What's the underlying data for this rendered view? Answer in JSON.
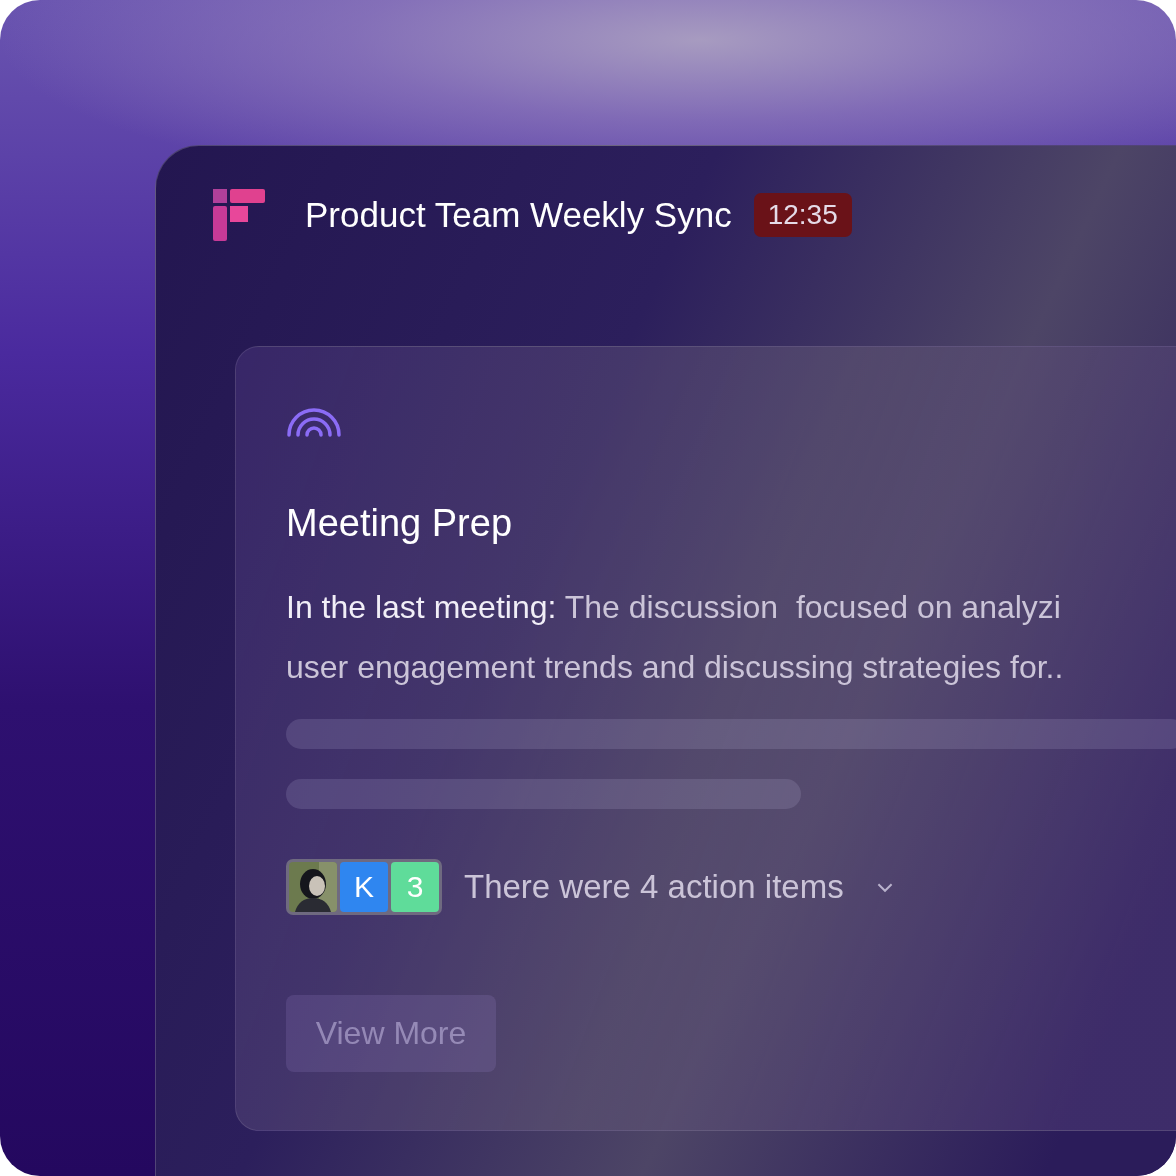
{
  "header": {
    "title": "Product Team Weekly Sync",
    "timer": "12:35"
  },
  "card": {
    "title": "Meeting Prep",
    "summary": {
      "lead": "In the last meeting:",
      "lines": [
        "The discussion  focused on analyzi",
        "user engagement trends and discussing strategies for.."
      ]
    },
    "placeholder_bars": [
      {
        "kind": "long"
      },
      {
        "kind": "short"
      }
    ],
    "avatars": [
      {
        "kind": "picture"
      },
      {
        "kind": "initial",
        "label": "K",
        "color": "#2f86f0"
      },
      {
        "kind": "count",
        "label": "3",
        "color": "#5fdc9a"
      }
    ],
    "action_items": {
      "label": "There were 4 action items",
      "expanded": false
    },
    "button": "View More"
  }
}
